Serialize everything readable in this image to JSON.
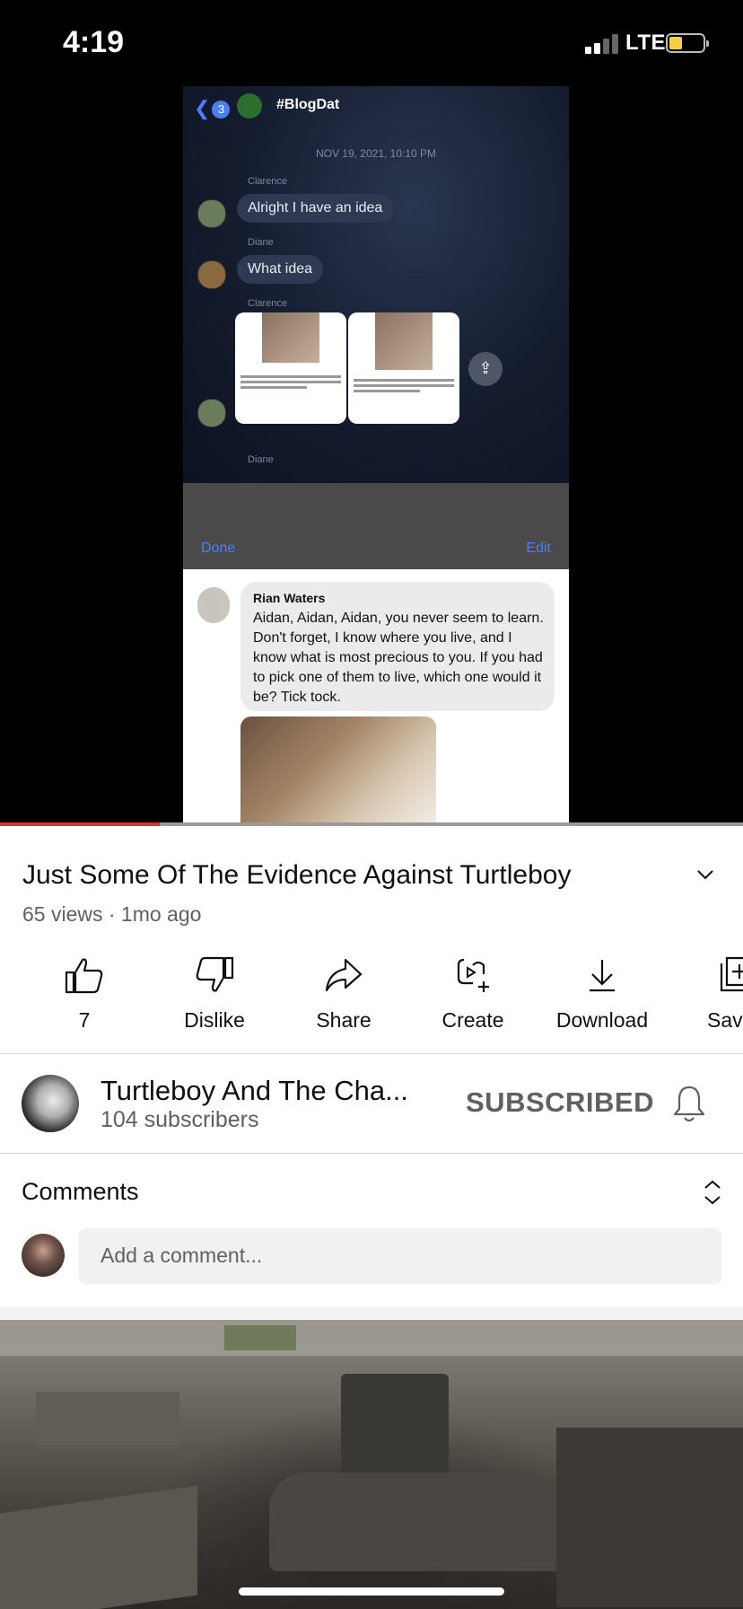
{
  "status_bar": {
    "time": "4:19",
    "network": "LTE"
  },
  "video": {
    "chat": {
      "back_count": "3",
      "title": "#BlogDat",
      "date": "NOV 19, 2021, 10:10 PM",
      "messages": [
        {
          "sender": "Clarence",
          "text": "Alright I have an idea"
        },
        {
          "sender": "Diane",
          "text": "What idea"
        },
        {
          "sender": "Clarence",
          "text": ""
        },
        {
          "sender": "Diane",
          "text": ""
        }
      ],
      "done_label": "Done",
      "edit_label": "Edit",
      "post": {
        "author": "Rian Waters",
        "text": "Aidan, Aidan, Aidan, you never seem to learn. Don't forget, I know where you live, and I know what is most precious to you. If you had to pick one of them to live, which one would it be? Tick tock."
      }
    },
    "progress_fraction": 0.215
  },
  "title": "Just Some Of The Evidence Against Turtleboy",
  "meta": "65 views · 1mo ago",
  "actions": [
    {
      "label": "7",
      "icon": "thumbs-up-icon"
    },
    {
      "label": "Dislike",
      "icon": "thumbs-down-icon"
    },
    {
      "label": "Share",
      "icon": "share-arrow-icon"
    },
    {
      "label": "Create",
      "icon": "create-sparkle-icon"
    },
    {
      "label": "Download",
      "icon": "download-icon"
    },
    {
      "label": "Sav",
      "icon": "save-playlist-icon"
    }
  ],
  "channel": {
    "name": "Turtleboy And The Cha...",
    "subscribers": "104 subscribers",
    "subscribe_label": "SUBSCRIBED"
  },
  "comments": {
    "header": "Comments",
    "placeholder": "Add a comment..."
  },
  "colors": {
    "progress": "#e52d27",
    "text": "#0f0f0f",
    "secondary_text": "#606060"
  }
}
